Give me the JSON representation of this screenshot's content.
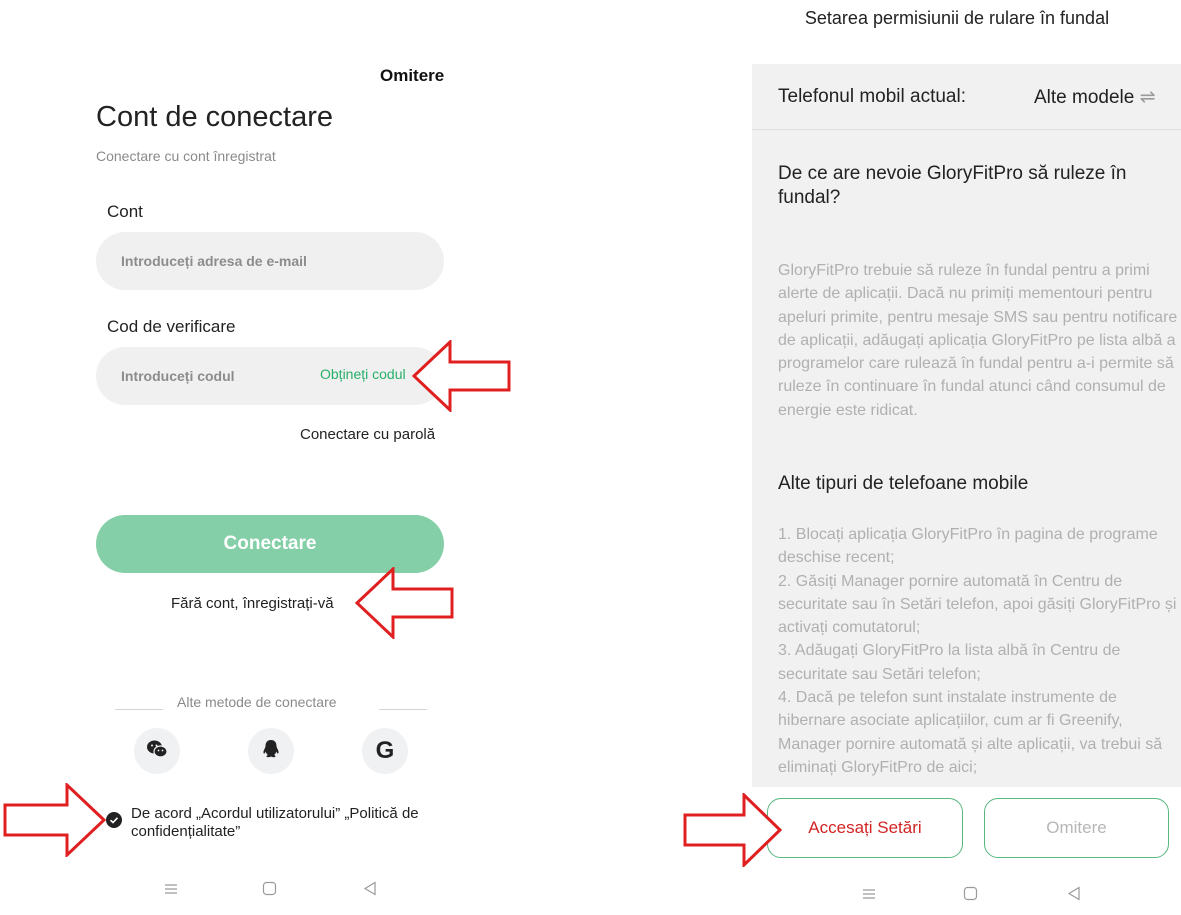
{
  "left": {
    "skip": "Omitere",
    "title": "Cont de conectare",
    "subtitle": "Conectare cu cont înregistrat",
    "account_label": "Cont",
    "email_placeholder": "Introduceți adresa de e-mail",
    "code_label": "Cod de verificare",
    "code_placeholder": "Introduceți codul",
    "get_code": "Obțineți codul",
    "password_login": "Conectare cu parolă",
    "login_button": "Conectare",
    "register": "Fără cont, înregistrați-vă",
    "other_methods": "Alte metode de conectare",
    "social_icons": [
      "wechat-icon",
      "qq-icon",
      "google-icon"
    ],
    "google_glyph": "G",
    "agreement": "De acord „Acordul utilizatorului” „Politică de confidențialitate”"
  },
  "right": {
    "title": "Setarea permisiunii de rulare în fundal",
    "current_phone_label": "Telefonul mobil actual:",
    "current_phone_value": "Alte modele",
    "why_heading": "De ce are nevoie GloryFitPro să ruleze în fundal?",
    "why_text": "GloryFitPro trebuie să ruleze în fundal pentru a primi alerte de aplicații. Dacă nu primiți mementouri pentru apeluri primite, pentru mesaje SMS sau pentru notificare de aplicații, adăugați aplicația GloryFitPro pe lista albă a programelor care rulează în fundal pentru a-i permite să ruleze în continuare în fundal atunci când consumul de energie este ridicat.",
    "other_heading": "Alte tipuri de telefoane mobile",
    "steps": [
      "1. Blocați aplicația GloryFitPro în pagina de programe deschise recent;",
      "2. Găsiți Manager pornire automată în Centru de securitate sau în Setări telefon, apoi găsiți GloryFitPro și activați comutatorul;",
      "3. Adăugați GloryFitPro la lista albă în Centru de securitate sau Setări telefon;",
      "4. Dacă pe telefon sunt instalate instrumente de hibernare asociate aplicațiilor, cum ar fi Greenify, Manager pornire automată și alte aplicații, va trebui să eliminați GloryFitPro de aici;"
    ],
    "access_button": "Accesați Setări",
    "skip_button": "Omitere"
  },
  "colors": {
    "accent_green": "#27b06a",
    "button_green": "#85cfa8",
    "annotation_red": "#e02020"
  }
}
